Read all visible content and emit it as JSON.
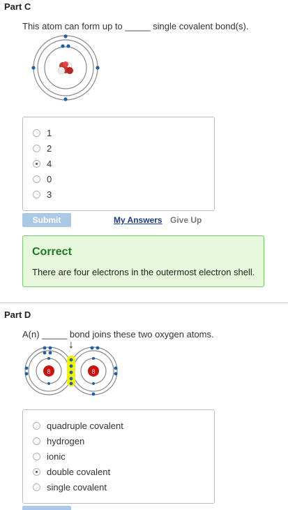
{
  "part_c": {
    "title": "Part C",
    "prompt": "This atom can form up to _____ single covalent bond(s).",
    "choices": [
      {
        "label": "1",
        "selected": false
      },
      {
        "label": "2",
        "selected": false
      },
      {
        "label": "4",
        "selected": true
      },
      {
        "label": "0",
        "selected": false
      },
      {
        "label": "3",
        "selected": false
      }
    ],
    "submit_label": "Submit",
    "my_answers_label": "My Answers",
    "give_up_label": "Give Up",
    "feedback": {
      "title": "Correct",
      "text": "There are four electrons in the outermost electron shell."
    }
  },
  "part_d": {
    "title": "Part D",
    "prompt": "A(n) _____ bond joins these two oxygen atoms.",
    "arrow": "↓",
    "nucleus_label": "8",
    "choices": [
      {
        "label": "quadruple covalent",
        "selected": false
      },
      {
        "label": "hydrogen",
        "selected": false
      },
      {
        "label": "ionic",
        "selected": false
      },
      {
        "label": "double covalent",
        "selected": true
      },
      {
        "label": "single covalent",
        "selected": false
      }
    ]
  },
  "colors": {
    "accent_link": "#1a3a8a",
    "submit_bg": "#a9c9e6",
    "correct_green": "#1e7a1e",
    "feedback_bg": "#e6f7dc",
    "electron_blue": "#1f5fa8",
    "nucleus_red": "#cc1111",
    "shared_yellow": "#f2f200"
  }
}
